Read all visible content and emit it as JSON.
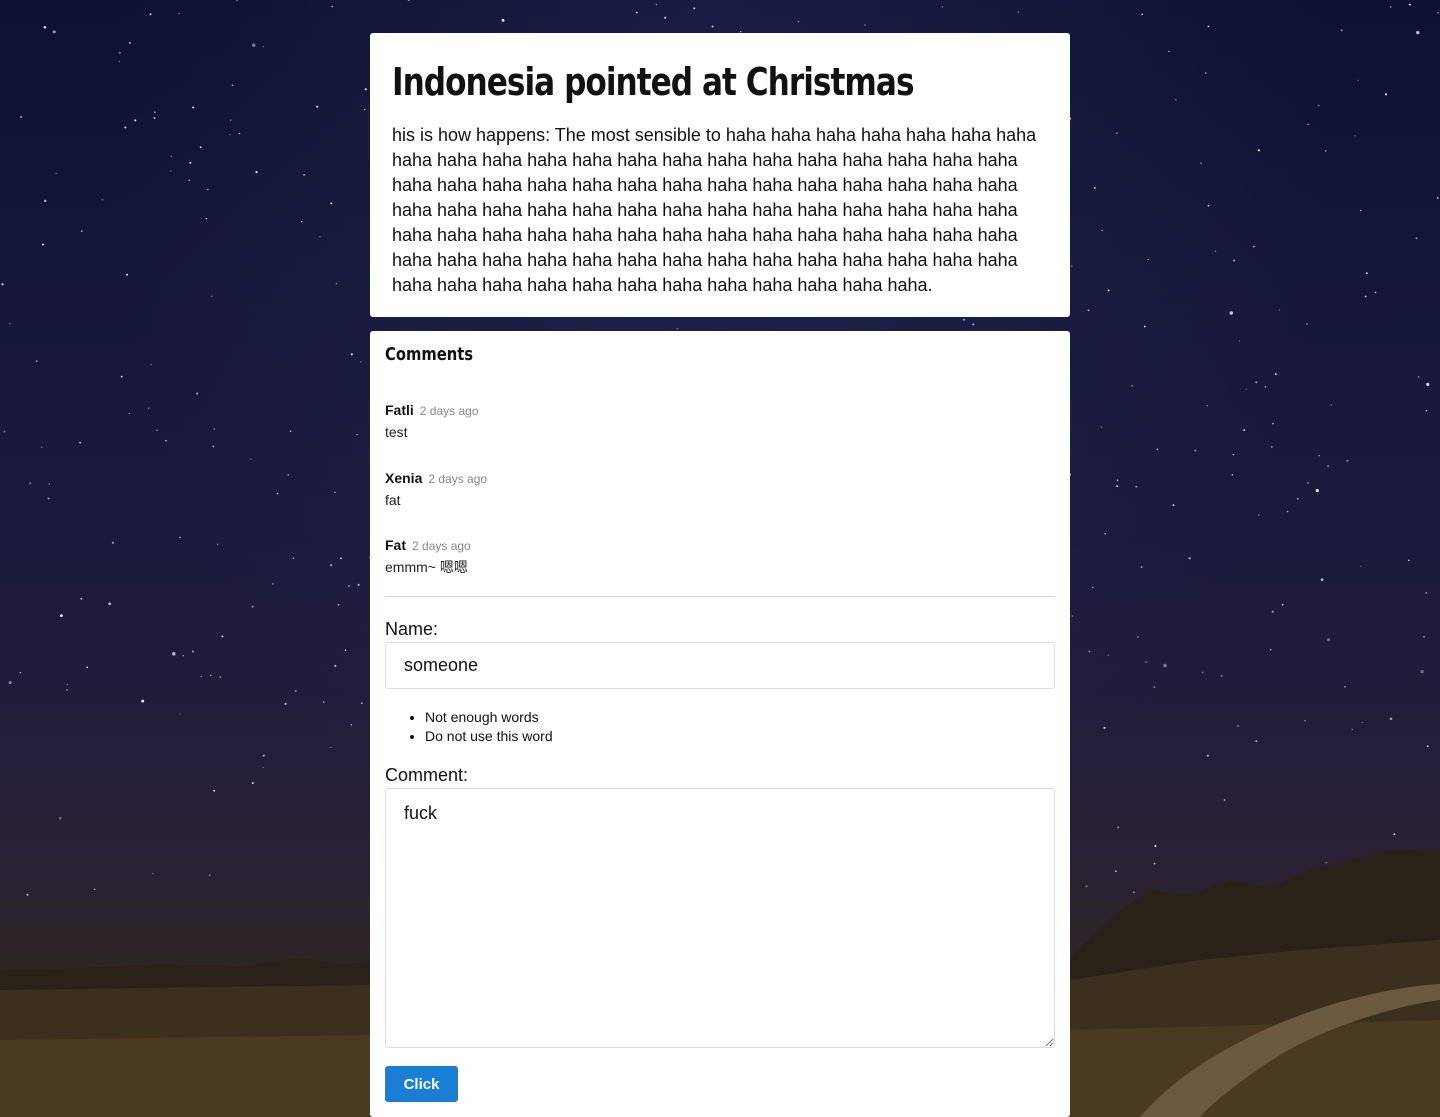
{
  "article": {
    "title": "Indonesia pointed at Christmas",
    "body": "his is how happens: The most sensible to haha haha haha haha haha haha haha haha haha haha haha haha haha haha haha haha haha haha haha haha haha haha haha haha haha haha haha haha haha haha haha haha haha haha haha haha haha haha haha haha haha haha haha haha haha haha haha haha haha haha haha haha haha haha haha haha haha haha haha haha haha haha haha haha haha haha haha haha haha haha haha haha haha haha haha haha haha haha haha haha haha haha haha haha haha haha haha haha haha."
  },
  "comments": {
    "title": "Comments",
    "items": [
      {
        "author": "Fatli",
        "time": "2 days ago",
        "text": "test"
      },
      {
        "author": "Xenia",
        "time": "2 days ago",
        "text": "fat"
      },
      {
        "author": "Fat",
        "time": "2 days ago",
        "text": "emmm~ 嗯嗯"
      }
    ]
  },
  "form": {
    "name_label": "Name:",
    "name_value": "someone",
    "errors": [
      "Not enough words",
      "Do not use this word"
    ],
    "comment_label": "Comment:",
    "comment_value": "fuck",
    "submit_label": "Click"
  },
  "colors": {
    "accent": "#1a7fd4",
    "card_bg": "#ffffff",
    "muted_text": "#888888"
  }
}
